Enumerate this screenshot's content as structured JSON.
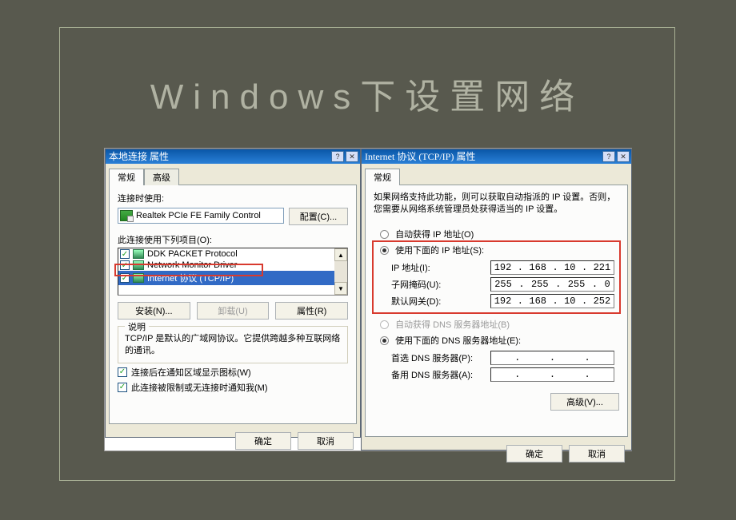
{
  "slide": {
    "title": "Windows下设置网络"
  },
  "dlg1": {
    "title": "本地连接 属性",
    "tabs": {
      "general": "常规",
      "advanced": "高级"
    },
    "conn_using": "连接时使用:",
    "adapter": "Realtek PCIe FE Family Control",
    "configure_btn": "配置(C)...",
    "items_label": "此连接使用下列项目(O):",
    "items": [
      {
        "name": "DDK PACKET Protocol",
        "checked": true,
        "sel": false
      },
      {
        "name": "Network Monitor Driver",
        "checked": true,
        "sel": false
      },
      {
        "name": "Internet 协议 (TCP/IP)",
        "checked": true,
        "sel": true
      }
    ],
    "install_btn": "安装(N)...",
    "uninstall_btn": "卸载(U)",
    "props_btn": "属性(R)",
    "desc_caption": "说明",
    "desc_text": "TCP/IP 是默认的广域网协议。它提供跨越多种互联网络的通讯。",
    "chk_tray": "连接后在通知区域显示图标(W)",
    "chk_notify": "此连接被限制或无连接时通知我(M)",
    "ok": "确定",
    "cancel": "取消"
  },
  "dlg2": {
    "title": "Internet 协议 (TCP/IP) 属性",
    "tab_general": "常规",
    "intro": "如果网络支持此功能，则可以获取自动指派的 IP 设置。否则，您需要从网络系统管理员处获得适当的 IP 设置。",
    "radio_auto_ip": "自动获得 IP 地址(O)",
    "radio_manual_ip": "使用下面的 IP 地址(S):",
    "ip_label": "IP 地址(I):",
    "ip_value": [
      "192",
      "168",
      "10",
      "221"
    ],
    "mask_label": "子网掩码(U):",
    "mask_value": [
      "255",
      "255",
      "255",
      "0"
    ],
    "gw_label": "默认网关(D):",
    "gw_value": [
      "192",
      "168",
      "10",
      "252"
    ],
    "radio_auto_dns": "自动获得 DNS 服务器地址(B)",
    "radio_manual_dns": "使用下面的 DNS 服务器地址(E):",
    "dns1_label": "首选 DNS 服务器(P):",
    "dns2_label": "备用 DNS 服务器(A):",
    "adv_btn": "高级(V)...",
    "ok": "确定",
    "cancel": "取消"
  }
}
